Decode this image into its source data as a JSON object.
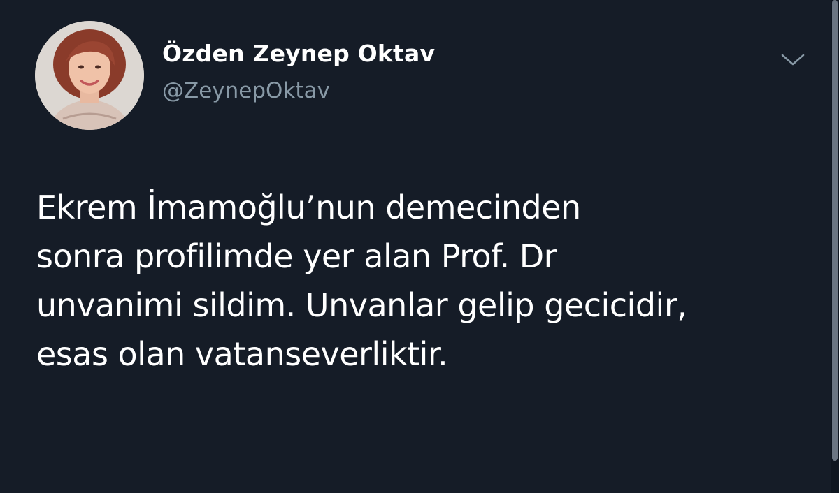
{
  "tweet": {
    "author": {
      "display_name": "Özden Zeynep Oktav",
      "handle": "@ZeynepOktav",
      "avatar_icon": "profile-photo"
    },
    "menu_icon": "chevron-down-icon",
    "text_lines": [
      "Ekrem İmamoğlu’nun demecinden",
      "sonra profilimde yer alan Prof. Dr",
      "unvanimi sildim. Unvanlar gelip gecicidir,",
      "esas olan vatanseverliktir."
    ]
  },
  "colors": {
    "background": "#151c27",
    "primary_text": "#ffffff",
    "secondary_text": "#8899a6"
  }
}
